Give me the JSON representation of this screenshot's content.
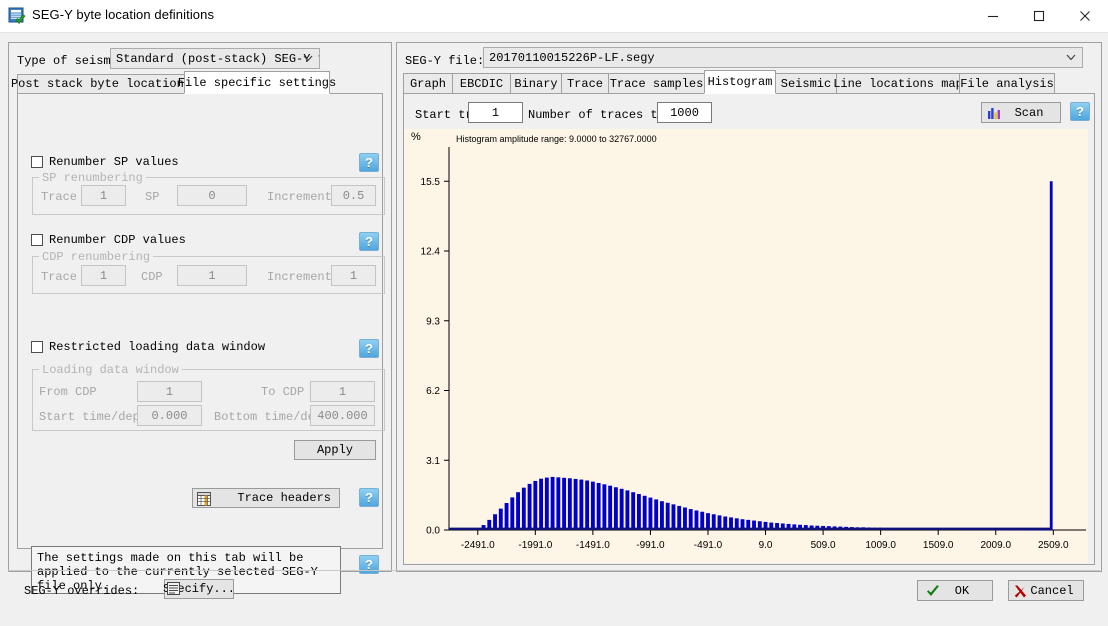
{
  "window": {
    "title": "SEG-Y byte location definitions",
    "icon": "segy-document-icon",
    "controls": {
      "minimize": "minimize-icon",
      "maximize": "maximize-icon",
      "close": "close-icon"
    }
  },
  "left": {
    "type_label": "Type of seismi",
    "type_value": "Standard (post-stack) SEG-Y files",
    "tabs": [
      {
        "label": "Post stack byte locations",
        "active": false
      },
      {
        "label": "File specific settings",
        "active": true
      }
    ],
    "sp": {
      "checkbox_label": "Renumber SP values",
      "checked": false,
      "group_title": "SP renumbering",
      "trace_label": "Trace",
      "trace_value": "1",
      "sp_label": "SP",
      "sp_value": "0",
      "increment_label": "Increment",
      "increment_value": "0.5"
    },
    "cdp": {
      "checkbox_label": "Renumber CDP values",
      "checked": false,
      "group_title": "CDP renumbering",
      "trace_label": "Trace",
      "trace_value": "1",
      "cdp_label": "CDP",
      "cdp_value": "1",
      "increment_label": "Increment",
      "increment_value": "1"
    },
    "restricted": {
      "checkbox_label": "Restricted loading data window",
      "checked": false,
      "group_title": "Loading data window",
      "from_cdp_label": "From CDP",
      "from_cdp_value": "1",
      "to_cdp_label": "To CDP",
      "to_cdp_value": "1",
      "start_label": "Start time/depth",
      "start_value": "0.000",
      "bottom_label": "Bottom time/depth",
      "bottom_value": "400.000"
    },
    "apply_label": "Apply",
    "trace_headers_label": "Trace headers",
    "note": "The settings made on this tab will be applied to the currently selected SEG-Y file only."
  },
  "right": {
    "file_label": "SEG-Y file:",
    "file_value": "20170110015226P-LF.segy",
    "tabs": [
      {
        "label": "Graph",
        "active": false
      },
      {
        "label": "EBCDIC",
        "active": false
      },
      {
        "label": "Binary",
        "active": false
      },
      {
        "label": "Trace",
        "active": false
      },
      {
        "label": "Trace samples",
        "active": false
      },
      {
        "label": "Histogram",
        "active": true
      },
      {
        "label": "Seismic",
        "active": false
      },
      {
        "label": "Line locations map",
        "active": false
      },
      {
        "label": "File analysis",
        "active": false
      }
    ],
    "start_trace_label": "Start tra",
    "start_trace_value": "1",
    "num_traces_label": "Number of traces to s",
    "num_traces_value": "1000",
    "scan_label": "Scan",
    "help_label": "?"
  },
  "footer": {
    "overrides_label": "SEG-Y overrides:",
    "specify_label": "Specify...",
    "ok_label": "OK",
    "cancel_label": "Cancel"
  },
  "colors": {
    "bar": "#0000cc",
    "chart_bg": "#fdf5e6",
    "accent_blue": "#4fa5dd",
    "ok_green": "#108010",
    "cancel_red": "#b40000"
  },
  "chart_data": {
    "type": "bar",
    "title": "Histogram amplitude range: 9.0000 to 32767.0000",
    "xlabel": "",
    "ylabel": "%",
    "xlim": [
      -2741,
      2741
    ],
    "ylim": [
      0,
      16.4
    ],
    "grid": false,
    "legend": null,
    "ytick_labels": [
      "0.0",
      "3.1",
      "6.2",
      "9.3",
      "12.4",
      "15.5"
    ],
    "ytick_values": [
      0.0,
      3.1,
      6.2,
      9.3,
      12.4,
      15.5
    ],
    "xtick_labels": [
      "-2491.0",
      "-1991.0",
      "-1491.0",
      "-991.0",
      "-491.0",
      "9.0",
      "509.0",
      "1009.0",
      "1509.0",
      "2009.0",
      "2509.0"
    ],
    "xtick_values": [
      -2491,
      -1991,
      -1491,
      -991,
      -491,
      9,
      509,
      1009,
      1509,
      2009,
      2509
    ],
    "x": [
      -2491,
      -2441,
      -2391,
      -2341,
      -2291,
      -2241,
      -2191,
      -2141,
      -2091,
      -2041,
      -1991,
      -1941,
      -1891,
      -1841,
      -1791,
      -1741,
      -1691,
      -1641,
      -1591,
      -1541,
      -1491,
      -1441,
      -1391,
      -1341,
      -1291,
      -1241,
      -1191,
      -1141,
      -1091,
      -1041,
      -991,
      -941,
      -891,
      -841,
      -791,
      -741,
      -691,
      -641,
      -591,
      -541,
      -491,
      -441,
      -391,
      -341,
      -291,
      -241,
      -191,
      -141,
      -91,
      -41,
      9,
      59,
      109,
      159,
      209,
      259,
      309,
      359,
      409,
      459,
      509,
      559,
      609,
      659,
      709,
      759,
      809,
      859,
      909,
      959,
      1009,
      1059,
      1109,
      1159,
      1209,
      1259,
      1309,
      1359,
      1409,
      1459,
      1509,
      1559,
      1609,
      1659,
      1709,
      1759,
      1809,
      1859,
      1909,
      1959,
      2009,
      2059,
      2109,
      2159,
      2209,
      2259,
      2309,
      2359,
      2409,
      2459,
      2491
    ],
    "values": [
      0.05,
      0.22,
      0.45,
      0.7,
      0.95,
      1.2,
      1.45,
      1.68,
      1.88,
      2.05,
      2.18,
      2.28,
      2.33,
      2.36,
      2.34,
      2.32,
      2.3,
      2.27,
      2.24,
      2.2,
      2.15,
      2.09,
      2.03,
      1.97,
      1.9,
      1.83,
      1.76,
      1.68,
      1.6,
      1.52,
      1.44,
      1.36,
      1.28,
      1.21,
      1.14,
      1.07,
      1.0,
      0.93,
      0.87,
      0.81,
      0.75,
      0.7,
      0.65,
      0.6,
      0.56,
      0.52,
      0.48,
      0.45,
      0.42,
      0.39,
      0.36,
      0.33,
      0.31,
      0.29,
      0.27,
      0.25,
      0.23,
      0.22,
      0.2,
      0.19,
      0.18,
      0.17,
      0.16,
      0.15,
      0.14,
      0.13,
      0.12,
      0.12,
      0.11,
      0.1,
      0.1,
      0.09,
      0.09,
      0.08,
      0.08,
      0.07,
      0.07,
      0.07,
      0.06,
      0.06,
      0.06,
      0.05,
      0.05,
      0.05,
      0.05,
      0.04,
      0.04,
      0.04,
      0.04,
      0.04,
      0.03,
      0.03,
      0.03,
      0.03,
      0.03,
      0.03,
      0.02,
      0.02,
      0.02,
      0.02,
      15.5
    ]
  }
}
